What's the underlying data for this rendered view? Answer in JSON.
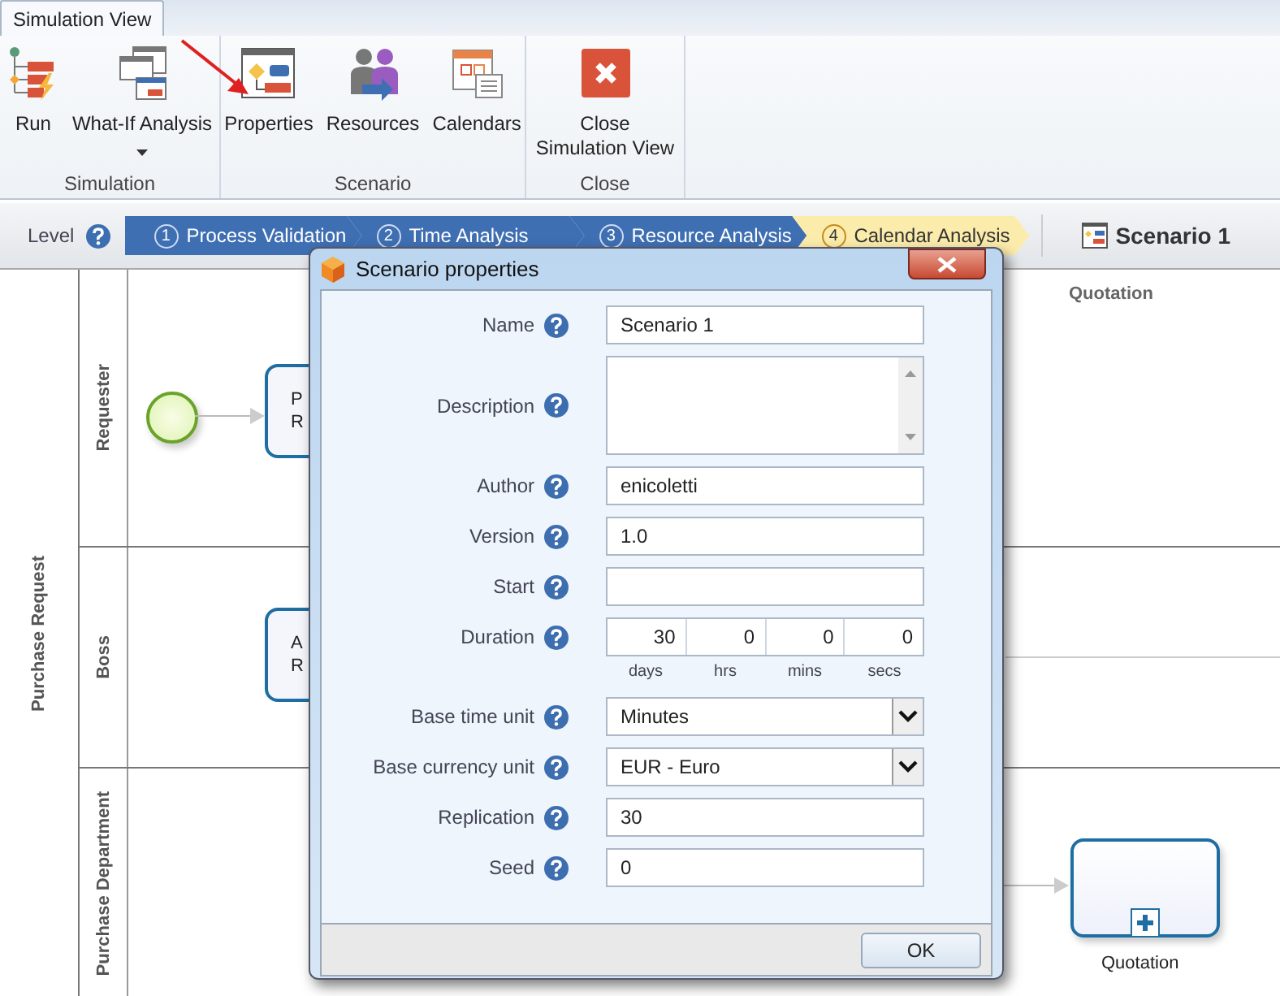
{
  "ribbon": {
    "tabs": [
      {
        "label": "Simulation View",
        "selected": true
      }
    ],
    "groups": [
      {
        "label": "Simulation",
        "buttons": [
          {
            "label": "Run",
            "kind": "run"
          },
          {
            "label": "What-If Analysis",
            "kind": "whatif",
            "dropdown": true
          }
        ]
      },
      {
        "label": "Scenario",
        "buttons": [
          {
            "label": "Properties",
            "kind": "properties"
          },
          {
            "label": "Resources",
            "kind": "resources"
          },
          {
            "label": "Calendars",
            "kind": "calendars"
          }
        ]
      },
      {
        "label": "Close",
        "buttons": [
          {
            "label": "Close Simulation View",
            "kind": "close"
          }
        ]
      }
    ]
  },
  "level_bar": {
    "label": "Level",
    "steps": [
      {
        "number": "1",
        "label": "Process Validation",
        "selected": false
      },
      {
        "number": "2",
        "label": "Time Analysis",
        "selected": false
      },
      {
        "number": "3",
        "label": "Resource Analysis",
        "selected": false
      },
      {
        "number": "4",
        "label": "Calendar Analysis",
        "selected": true
      }
    ],
    "scenario": "Scenario 1"
  },
  "diagram": {
    "pool": "Purchase Request",
    "column_header": "Quotation",
    "lanes": [
      {
        "name": "Requester",
        "tasks": [
          {
            "lines": [
              "P",
              "R"
            ]
          }
        ]
      },
      {
        "name": "Boss",
        "tasks": [
          {
            "lines": [
              "A",
              "R"
            ]
          }
        ]
      },
      {
        "name": "Purchase Department",
        "subprocess": "Quotation"
      }
    ]
  },
  "dialog": {
    "title": "Scenario properties",
    "fields": [
      {
        "label": "Name",
        "kind": "text",
        "value": "Scenario 1"
      },
      {
        "label": "Description",
        "kind": "textarea"
      },
      {
        "label": "Author",
        "kind": "text",
        "value": "enicoletti"
      },
      {
        "label": "Version",
        "kind": "text",
        "value": "1.0"
      },
      {
        "label": "Start",
        "kind": "text"
      },
      {
        "label": "Duration",
        "kind": "duration",
        "parts": [
          {
            "value": "30",
            "unit": "days"
          },
          {
            "value": "0",
            "unit": "hrs"
          },
          {
            "value": "0",
            "unit": "mins"
          },
          {
            "value": "0",
            "unit": "secs"
          }
        ]
      },
      {
        "label": "Base time unit",
        "kind": "select",
        "value": "Minutes"
      },
      {
        "label": "Base currency unit",
        "kind": "select",
        "value": "EUR - Euro"
      },
      {
        "label": "Replication",
        "kind": "text",
        "value": "30"
      },
      {
        "label": "Seed",
        "kind": "text",
        "value": "0"
      }
    ],
    "ok": "OK"
  }
}
